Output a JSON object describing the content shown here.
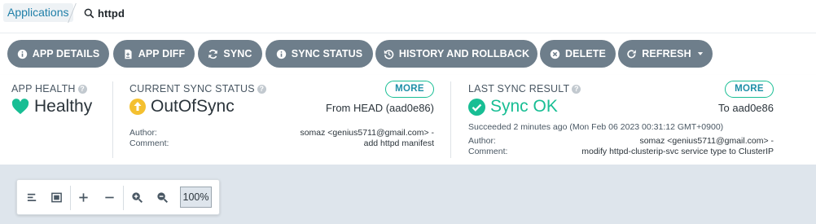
{
  "breadcrumb": {
    "label": "Applications"
  },
  "search": {
    "value": "httpd"
  },
  "actions": [
    {
      "label": "APP DETAILS",
      "icon": "info-circle-icon"
    },
    {
      "label": "APP DIFF",
      "icon": "file-diff-icon"
    },
    {
      "label": "SYNC",
      "icon": "sync-icon"
    },
    {
      "label": "SYNC STATUS",
      "icon": "info-circle-icon"
    },
    {
      "label": "HISTORY AND ROLLBACK",
      "icon": "history-icon"
    },
    {
      "label": "DELETE",
      "icon": "times-circle-icon"
    },
    {
      "label": "REFRESH",
      "icon": "redo-icon"
    }
  ],
  "health": {
    "title": "APP HEALTH",
    "status": "Healthy",
    "color": "#18be94"
  },
  "sync_status": {
    "title": "CURRENT SYNC STATUS",
    "status": "OutOfSync",
    "color": "#f4c030",
    "more_label": "MORE",
    "from": "From HEAD (aad0e86)",
    "author_label": "Author:",
    "author_value": "somaz <genius5711@gmail.com> -",
    "comment_label": "Comment:",
    "comment_value": "add httpd manifest"
  },
  "last_sync": {
    "title": "LAST SYNC RESULT",
    "status": "Sync OK",
    "color": "#18be94",
    "more_label": "MORE",
    "to": "To aad0e86",
    "succeeded": "Succeeded 2 minutes ago (Mon Feb 06 2023 00:31:12 GMT+0900)",
    "author_label": "Author:",
    "author_value": "somaz <genius5711@gmail.com> -",
    "comment_label": "Comment:",
    "comment_value": "modify httpd-clusterip-svc service type to ClusterIP"
  },
  "toolbar": {
    "zoom": "100%"
  },
  "colors": {
    "button_bg": "#6e7e8b",
    "accent_teal": "#18be94",
    "link": "#1f7fa8",
    "canvas_bg": "#dee5ec"
  }
}
